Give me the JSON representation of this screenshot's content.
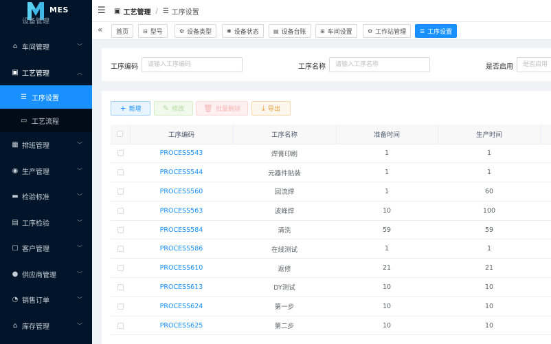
{
  "app": {
    "logo_text": "MES"
  },
  "sidebar": {
    "partial_item": {
      "label": "设备管理"
    },
    "items": [
      {
        "label": "车间管理",
        "icon": "building-icon",
        "glyph": "⌂",
        "expanded": false
      },
      {
        "label": "工艺管理",
        "icon": "briefcase-icon",
        "glyph": "▣",
        "expanded": true,
        "children": [
          {
            "label": "工序设置",
            "icon": "database-icon",
            "glyph": "☰",
            "active": true
          },
          {
            "label": "工艺流程",
            "icon": "layers-icon",
            "glyph": "▭",
            "active": false
          }
        ]
      },
      {
        "label": "排班管理",
        "icon": "calendar-icon",
        "glyph": "▦",
        "expanded": false
      },
      {
        "label": "生产管理",
        "icon": "cylinder-icon",
        "glyph": "◉",
        "expanded": false
      },
      {
        "label": "检验标准",
        "icon": "monitor-icon",
        "glyph": "▬",
        "expanded": false
      },
      {
        "label": "工序检验",
        "icon": "book-icon",
        "glyph": "▤",
        "expanded": false
      },
      {
        "label": "客户管理",
        "icon": "contact-icon",
        "glyph": "▢",
        "expanded": false
      },
      {
        "label": "供应商管理",
        "icon": "user-icon",
        "glyph": "●",
        "expanded": false
      },
      {
        "label": "销售订单",
        "icon": "chart-icon",
        "glyph": "◔",
        "expanded": false
      },
      {
        "label": "库存管理",
        "icon": "warehouse-icon",
        "glyph": "⌂",
        "expanded": false
      }
    ]
  },
  "header": {
    "breadcrumb": [
      {
        "label": "工艺管理"
      },
      {
        "label": "工序设置"
      }
    ]
  },
  "tabs": [
    {
      "label": "首页",
      "icon": "",
      "active": false
    },
    {
      "label": "型号",
      "icon": "⊟",
      "active": false
    },
    {
      "label": "设备类型",
      "icon": "⚙",
      "active": false
    },
    {
      "label": "设备状态",
      "icon": "✱",
      "active": false
    },
    {
      "label": "设备台账",
      "icon": "▤",
      "active": false
    },
    {
      "label": "车间设置",
      "icon": "⊞",
      "active": false
    },
    {
      "label": "工作站管理",
      "icon": "⚙",
      "active": false
    },
    {
      "label": "工序设置",
      "icon": "☰",
      "active": true
    }
  ],
  "search": {
    "fields": [
      {
        "label": "工序编码",
        "placeholder": "请输入工序编码"
      },
      {
        "label": "工序名称",
        "placeholder": "请输入工序名称"
      },
      {
        "label": "是否启用",
        "placeholder": "是否启用"
      }
    ]
  },
  "toolbar": {
    "add_label": "新增",
    "edit_label": "修改",
    "delete_label": "批量删除",
    "export_label": "导出"
  },
  "table": {
    "columns": [
      "工序编码",
      "工序名称",
      "准备时间",
      "生产时间"
    ],
    "rows": [
      {
        "code": "PROCESS543",
        "name": "焊膏印刷",
        "prep": "1",
        "prod": "1"
      },
      {
        "code": "PROCESS544",
        "name": "元器件贴装",
        "prep": "1",
        "prod": "1"
      },
      {
        "code": "PROCESS560",
        "name": "回流焊",
        "prep": "1",
        "prod": "60"
      },
      {
        "code": "PROCESS563",
        "name": "波峰焊",
        "prep": "10",
        "prod": "100"
      },
      {
        "code": "PROCESS584",
        "name": "清洗",
        "prep": "59",
        "prod": "59"
      },
      {
        "code": "PROCESS586",
        "name": "在线测试",
        "prep": "1",
        "prod": "1"
      },
      {
        "code": "PROCESS610",
        "name": "返修",
        "prep": "21",
        "prod": "21"
      },
      {
        "code": "PROCESS613",
        "name": "DY测试",
        "prep": "10",
        "prod": "10"
      },
      {
        "code": "PROCESS624",
        "name": "第一步",
        "prep": "10",
        "prod": "10"
      },
      {
        "code": "PROCESS625",
        "name": "第二步",
        "prep": "10",
        "prod": "10"
      }
    ]
  }
}
